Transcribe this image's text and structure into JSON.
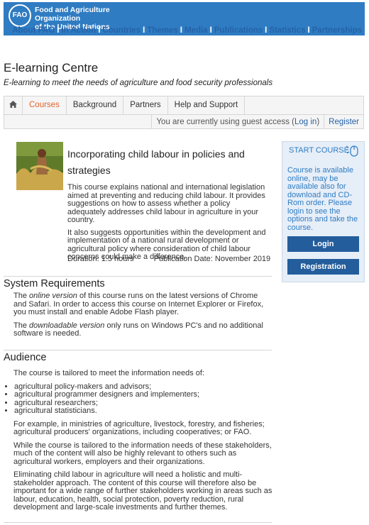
{
  "header": {
    "logo_text": "FAO",
    "org_line1": "Food and Agriculture Organization",
    "org_line2": "of the United Nations",
    "nav": [
      "About FAO",
      "In Action",
      "Countries",
      "Themes",
      "Media",
      "Publications",
      "Statistics",
      "Partnerships"
    ],
    "nav_sep": "I"
  },
  "site": {
    "title": "E-learning Centre",
    "tagline": "E-learning to meet the needs of agriculture and food security professionals"
  },
  "navbar": {
    "tabs": [
      "Courses",
      "Background",
      "Partners",
      "Help and Support"
    ],
    "guest_prefix": "You are currently using guest access (",
    "login_link": "Log in",
    "guest_suffix": ")",
    "register": "Register"
  },
  "course": {
    "title": "Incorporating child labour in policies and strategies",
    "desc1": "This course explains national and international legislation aimed at preventing and reducing child labour. It provides suggestions on how to assess whether a policy adequately addresses child labour in agriculture in your country.",
    "desc2": "It also suggests opportunities within the development and implementation of a national rural development or agricultural policy where consideration of child labour concerns could make a difference.",
    "duration": "Duration:  1.5 hours",
    "publication": "Publication Date:  November 2019"
  },
  "start_panel": {
    "title": "START COURSE",
    "text": "Course is available online, may be available also for download and CD-Rom order. Please login to see the options and take the course.",
    "login_button": "Login",
    "register_button": "Registration"
  },
  "requirements": {
    "heading": "System Requirements",
    "p1_pre": "The ",
    "p1_em": "online version",
    "p1_post": " of this course runs on the latest versions of Chrome and Safari. In order to access this course on Internet Explorer or Firefox, you must install and enable Adobe Flash player.",
    "p2_pre": "The ",
    "p2_em": "downloadable version",
    "p2_post": " only runs on Windows PC's and no additional software is needed."
  },
  "audience": {
    "heading": "Audience",
    "intro": "The course is tailored to meet the information needs of:",
    "items": [
      "agricultural policy-makers and advisors;",
      "agricultural programmer designers and implementers;",
      "agricultural researchers;",
      "agricultural statisticians."
    ],
    "p2": "For example, in ministries of agriculture, livestock, forestry, and fisheries; agricultural producers' organizations, including cooperatives; or FAO.",
    "p3": "While the course is tailored to the information needs of these stakeholders, much of the content will also be highly relevant to others such as agricultural workers, employers and their organizations.",
    "p4": "Eliminating child labour in agriculture will need a holistic and multi-stakeholder approach. The content of this course will therefore also be important for a wide range of further stakeholders working in areas such as labour, education, health, social protection, poverty reduction, rural development and large-scale investments and further themes."
  }
}
